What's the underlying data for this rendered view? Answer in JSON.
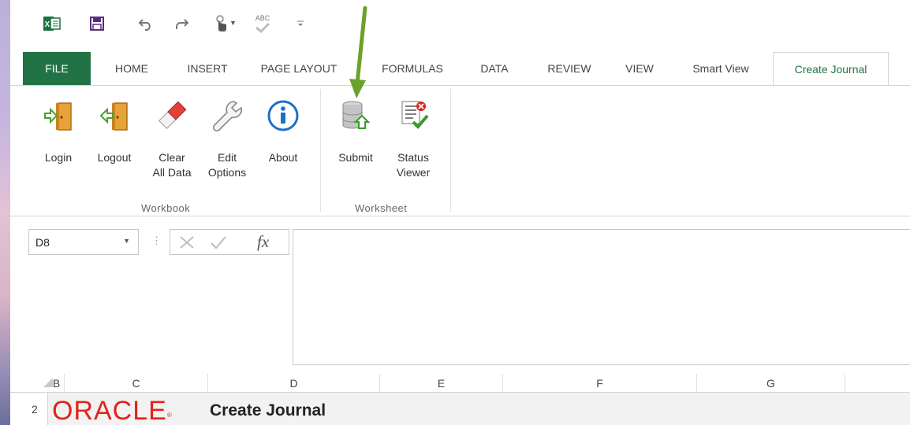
{
  "quick_access": {
    "items": [
      "excel-logo-icon",
      "save-icon",
      "undo-icon",
      "redo-icon",
      "touch-mode-icon",
      "spelling-icon",
      "customize-icon"
    ],
    "spelling_icon_text": "ABC"
  },
  "tabs": [
    {
      "label": "FILE"
    },
    {
      "label": "HOME"
    },
    {
      "label": "INSERT"
    },
    {
      "label": "PAGE LAYOUT"
    },
    {
      "label": "FORMULAS"
    },
    {
      "label": "DATA"
    },
    {
      "label": "REVIEW"
    },
    {
      "label": "VIEW"
    },
    {
      "label": "Smart View"
    },
    {
      "label": "Create Journal"
    }
  ],
  "active_tab": "Create Journal",
  "ribbon": {
    "groups": [
      {
        "label": "Workbook",
        "buttons": [
          {
            "label": "Login",
            "icon": "login-door-icon"
          },
          {
            "label": "Logout",
            "icon": "logout-door-icon"
          },
          {
            "label": "Clear All Data",
            "line1": "Clear",
            "line2": "All Data",
            "icon": "eraser-icon"
          },
          {
            "label": "Edit Options",
            "line1": "Edit",
            "line2": "Options",
            "icon": "wrench-icon"
          },
          {
            "label": "About",
            "icon": "info-icon"
          }
        ]
      },
      {
        "label": "Worksheet",
        "buttons": [
          {
            "label": "Submit",
            "icon": "database-upload-icon"
          },
          {
            "label": "Status Viewer",
            "line1": "Status",
            "line2": "Viewer",
            "icon": "status-list-icon"
          }
        ]
      }
    ]
  },
  "formula_bar": {
    "name_box_value": "D8",
    "fx_label": "fx",
    "formula_value": ""
  },
  "columns": [
    "B",
    "C",
    "D",
    "E",
    "F",
    "G"
  ],
  "rows": [
    {
      "number": "2",
      "logo_text": "ORACLE",
      "title": "Create Journal"
    }
  ],
  "colors": {
    "file_tab": "#217346",
    "active_tab_text": "#217346",
    "oracle_red": "#e2231a",
    "annotation_arrow": "#6aa22c"
  }
}
